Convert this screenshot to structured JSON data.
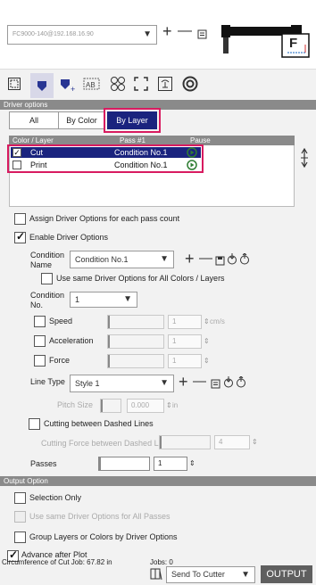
{
  "device": {
    "selector_value": "FC9000-140@192.168.16.90",
    "cutter_label": "F"
  },
  "toolbar": {
    "add": "+",
    "remove": "—"
  },
  "driver_options": {
    "section_title": "Driver options",
    "tabs": [
      "All",
      "By Color",
      "By Layer"
    ],
    "table_headers": {
      "col1": "Color / Layer",
      "col2": "Pass #1",
      "col3": "Pause"
    },
    "rows": [
      {
        "name": "Cut",
        "condition": "Condition No.1",
        "checked": true
      },
      {
        "name": "Print",
        "condition": "Condition No.1",
        "checked": false
      }
    ],
    "assign_label": "Assign Driver Options for each pass count",
    "enable_label": "Enable Driver Options",
    "condition_name_label": "Condition Name",
    "condition_name_value": "Condition No.1",
    "use_same_label": "Use same Driver Options for All Colors / Layers",
    "condition_no_label": "Condition No.",
    "condition_no_value": "1",
    "speed_label": "Speed",
    "speed_value": "1",
    "speed_unit": "cm/s",
    "accel_label": "Acceleration",
    "accel_value": "1",
    "force_label": "Force",
    "force_value": "1",
    "line_type_label": "Line Type",
    "line_type_value": "Style 1",
    "pitch_label": "Pitch Size",
    "pitch_value": "0.000",
    "pitch_unit": "in",
    "dashed_label": "Cutting between Dashed Lines",
    "dashed_force_label": "Cutting Force between Dashed Lines",
    "dashed_force_value": "4",
    "passes_label": "Passes",
    "passes_value": "1"
  },
  "output_option": {
    "section_title": "Output Option",
    "selection_only": "Selection Only",
    "use_same_passes": "Use same Driver Options for All Passes",
    "group_layers": "Group Layers or Colors by Driver Options",
    "advance_after": "Advance after Plot"
  },
  "footer": {
    "circumference": "Circumference of Cut Job: 67.82 in",
    "jobs": "Jobs: 0",
    "send_to": "Send To Cutter",
    "output_button": "OUTPUT"
  },
  "colors": {
    "accent": "#d81b60",
    "selection": "#1a237e",
    "section": "#8a8a8a"
  }
}
